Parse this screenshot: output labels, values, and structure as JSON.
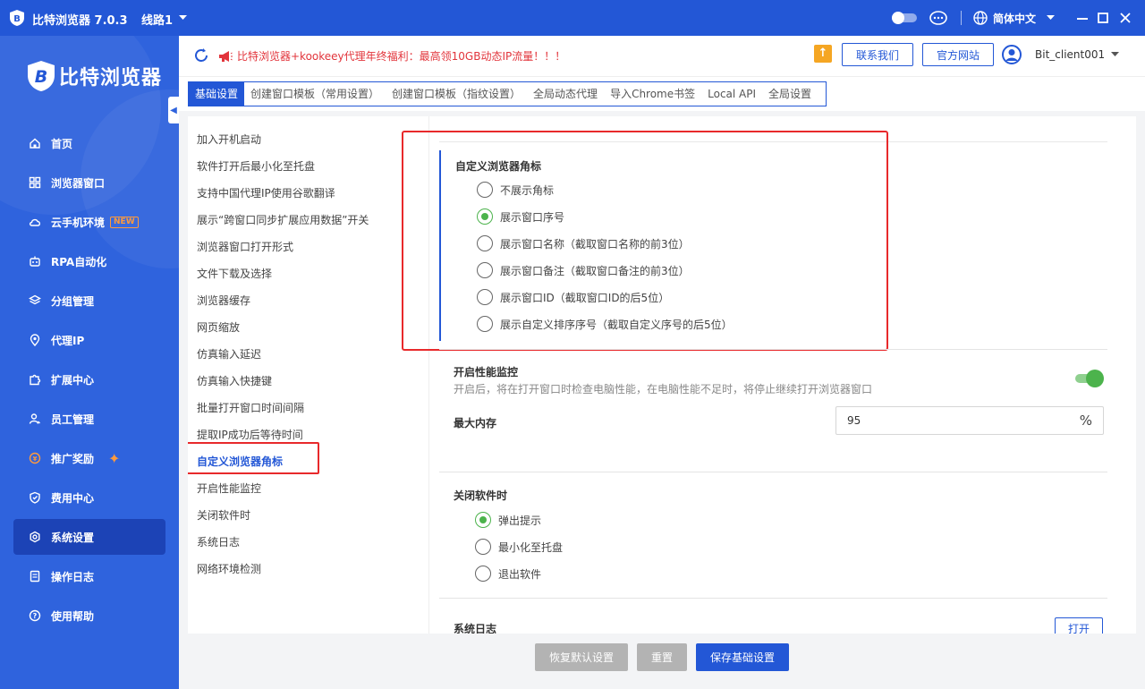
{
  "titlebar": {
    "app_title": "比特浏览器 7.0.3",
    "line_label": "线路1",
    "language": "简体中文"
  },
  "sidebar": {
    "brand": "比特浏览器",
    "items": [
      {
        "label": "首页",
        "icon": "home-icon"
      },
      {
        "label": "浏览器窗口",
        "icon": "grid-icon"
      },
      {
        "label": "云手机环境",
        "icon": "cloud-icon",
        "badge": "NEW"
      },
      {
        "label": "RPA自动化",
        "icon": "robot-icon"
      },
      {
        "label": "分组管理",
        "icon": "layers-icon"
      },
      {
        "label": "代理IP",
        "icon": "location-pin-icon"
      },
      {
        "label": "扩展中心",
        "icon": "puzzle-icon"
      },
      {
        "label": "员工管理",
        "icon": "users-icon"
      },
      {
        "label": "推广奖励",
        "icon": "coin-icon"
      },
      {
        "label": "费用中心",
        "icon": "shield-icon"
      },
      {
        "label": "系统设置",
        "icon": "gear-icon",
        "active": true
      },
      {
        "label": "操作日志",
        "icon": "log-icon"
      },
      {
        "label": "使用帮助",
        "icon": "help-icon"
      }
    ]
  },
  "topbar": {
    "promo_text": "比特浏览器+kookeey代理年终福利：最高领10GB动态IP流量！！！",
    "contact_label": "联系我们",
    "website_label": "官方网站",
    "username": "Bit_client001"
  },
  "tabs": [
    {
      "label": "基础设置",
      "active": true
    },
    {
      "label": "创建窗口模板（常用设置）"
    },
    {
      "label": "创建窗口模板（指纹设置）"
    },
    {
      "label": "全局动态代理"
    },
    {
      "label": "导入Chrome书签"
    },
    {
      "label": "Local API"
    },
    {
      "label": "全局设置"
    }
  ],
  "settings_menu": [
    "加入开机启动",
    "软件打开后最小化至托盘",
    "支持中国代理IP使用谷歌翻译",
    "展示“跨窗口同步扩展应用数据”开关",
    "浏览器窗口打开形式",
    "文件下载及选择",
    "浏览器缓存",
    "网页缩放",
    "仿真输入延迟",
    "仿真输入快捷键",
    "批量打开窗口时间间隔",
    "提取IP成功后等待时间",
    "自定义浏览器角标",
    "开启性能监控",
    "关闭软件时",
    "系统日志",
    "网络环境检测"
  ],
  "badge_section": {
    "title": "自定义浏览器角标",
    "options": [
      {
        "label": "不展示角标",
        "checked": false
      },
      {
        "label": "展示窗口序号",
        "checked": true
      },
      {
        "label": "展示窗口名称（截取窗口名称的前3位）",
        "checked": false
      },
      {
        "label": "展示窗口备注（截取窗口备注的前3位）",
        "checked": false
      },
      {
        "label": "展示窗口ID（截取窗口ID的后5位）",
        "checked": false
      },
      {
        "label": "展示自定义排序序号（截取自定义序号的后5位）",
        "checked": false
      }
    ]
  },
  "perf_section": {
    "title": "开启性能监控",
    "description": "开启后，将在打开窗口时检查电脑性能，在电脑性能不足时，将停止继续打开浏览器窗口",
    "enabled": true,
    "max_memory_label": "最大内存",
    "max_memory_value": "95",
    "max_memory_unit": "%"
  },
  "close_section": {
    "title": "关闭软件时",
    "options": [
      {
        "label": "弹出提示",
        "checked": true
      },
      {
        "label": "最小化至托盘",
        "checked": false
      },
      {
        "label": "退出软件",
        "checked": false
      }
    ]
  },
  "log_section": {
    "title": "系统日志",
    "open_label": "打开"
  },
  "footer": {
    "restore_label": "恢复默认设置",
    "reset_label": "重置",
    "save_label": "保存基础设置"
  },
  "colors": {
    "primary": "#2357d6",
    "sidebar": "#2f63dd",
    "active_nav": "#1c43b6",
    "checked": "#4cb34c",
    "highlight": "#e8292b",
    "promo": "#e2343b",
    "button_gray": "#b3b3b3"
  }
}
